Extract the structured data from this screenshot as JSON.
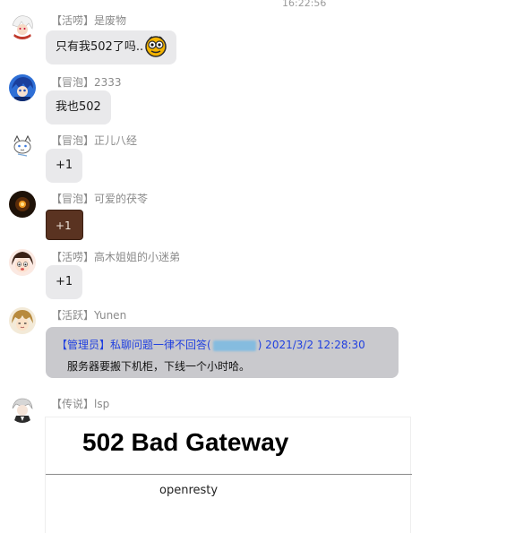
{
  "timestamp": "16:22:56",
  "messages": [
    {
      "title": "【活唠】",
      "name": "是废物",
      "text": "只有我502了吗.."
    },
    {
      "title": "【冒泡】",
      "name": "2333",
      "text": "我也502"
    },
    {
      "title": "【冒泡】",
      "name": "正儿八经",
      "text": "+1"
    },
    {
      "title": "【冒泡】",
      "name": "可爱的茯苓",
      "text": "+1"
    },
    {
      "title": "【活唠】",
      "name": "高木姐姐的小迷弟",
      "text": "+1"
    },
    {
      "title": "【活跃】",
      "name": "Yunen"
    },
    {
      "title": "【传说】",
      "name": "lsp"
    }
  ],
  "quote": {
    "line1_prefix": "【管理员】私聊问题一律不回答(",
    "line1_suffix": ") 2021/3/2 12:28:30",
    "line2": "服务器要搬下机柜，下线一个小时哈。"
  },
  "error_page": {
    "heading": "502 Bad Gateway",
    "server": "openresty"
  }
}
